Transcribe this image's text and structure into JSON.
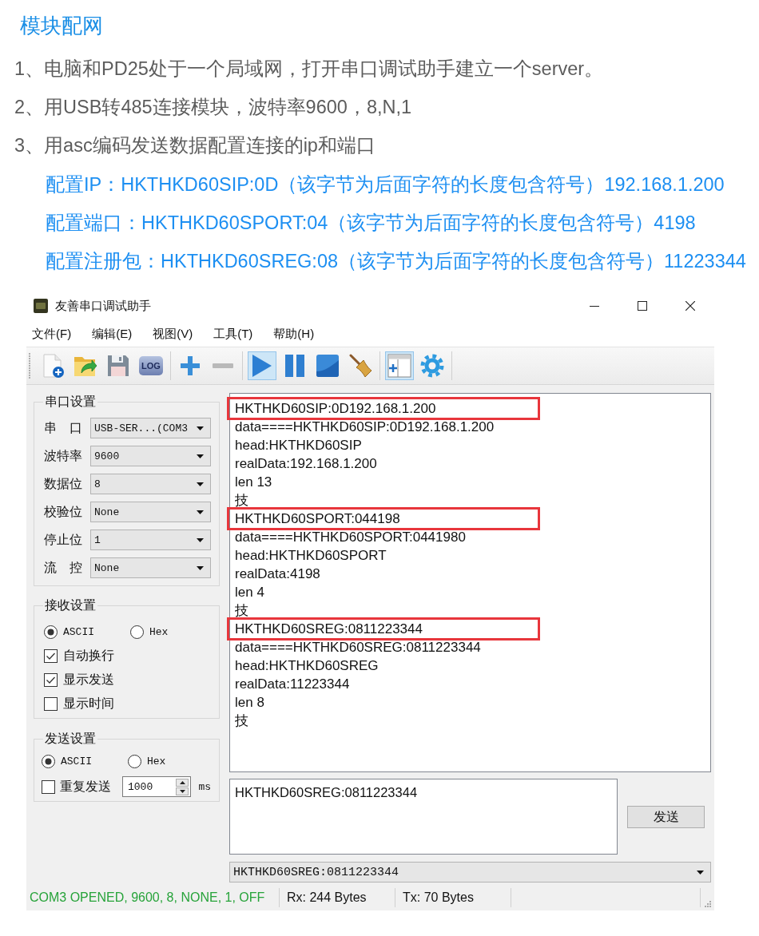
{
  "doc": {
    "heading": "模块配网",
    "steps": [
      "1、电脑和PD25处于一个局域网，打开串口调试助手建立一个server。",
      "2、用USB转485连接模块，波特率9600，8,N,1",
      "3、用asc编码发送数据配置连接的ip和端口"
    ],
    "configs": [
      "配置IP：HKTHKD60SIP:0D（该字节为后面字符的长度包含符号）192.168.1.200",
      "配置端口：HKTHKD60SPORT:04（该字节为后面字符的长度包含符号）4198",
      "配置注册包：HKTHKD60SREG:08（该字节为后面字符的长度包含符号）11223344"
    ]
  },
  "window": {
    "title": "友善串口调试助手"
  },
  "menu": [
    "文件(F)",
    "编辑(E)",
    "视图(V)",
    "工具(T)",
    "帮助(H)"
  ],
  "toolbar": [
    [
      {
        "kind": "new-file",
        "pressed": false
      },
      {
        "kind": "open-folder",
        "pressed": false
      },
      {
        "kind": "save",
        "pressed": false
      },
      {
        "kind": "log",
        "label": "LOG",
        "pressed": false
      }
    ],
    [
      {
        "kind": "plus",
        "pressed": false
      },
      {
        "kind": "minus",
        "pressed": false
      }
    ],
    [
      {
        "kind": "play",
        "pressed": true
      },
      {
        "kind": "pause",
        "pressed": false
      },
      {
        "kind": "stop",
        "pressed": false
      },
      {
        "kind": "broom",
        "pressed": false
      }
    ],
    [
      {
        "kind": "window-add",
        "pressed": true
      },
      {
        "kind": "gear",
        "pressed": false
      }
    ]
  ],
  "serial_settings": {
    "title": "串口设置",
    "fields": [
      {
        "label": "串 口",
        "value": "USB-SER...(COM3"
      },
      {
        "label": "波特率",
        "value": "9600"
      },
      {
        "label": "数据位",
        "value": "8"
      },
      {
        "label": "校验位",
        "value": "None"
      },
      {
        "label": "停止位",
        "value": "1"
      },
      {
        "label": "流 控",
        "value": "None"
      }
    ]
  },
  "receive_settings": {
    "title": "接收设置",
    "modes": [
      {
        "label": "ASCII",
        "selected": true
      },
      {
        "label": "Hex",
        "selected": false
      }
    ],
    "options": [
      {
        "label": "自动换行",
        "checked": true
      },
      {
        "label": "显示发送",
        "checked": true
      },
      {
        "label": "显示时间",
        "checked": false
      }
    ]
  },
  "send_settings": {
    "title": "发送设置",
    "modes": [
      {
        "label": "ASCII",
        "selected": true
      },
      {
        "label": "Hex",
        "selected": false
      }
    ],
    "repeat": {
      "label": "重复发送",
      "checked": false,
      "interval": "1000",
      "unit": "ms"
    }
  },
  "receive_area": {
    "lines": [
      {
        "text": "HKTHKD60SIP:0D192.168.1.200",
        "highlighted": true
      },
      {
        "text": "data====HKTHKD60SIP:0D192.168.1.200",
        "highlighted": false
      },
      {
        "text": "head:HKTHKD60SIP",
        "highlighted": false
      },
      {
        "text": "realData:192.168.1.200",
        "highlighted": false
      },
      {
        "text": "len 13",
        "highlighted": false
      },
      {
        "text": "技",
        "highlighted": false
      },
      {
        "text": "HKTHKD60SPORT:044198",
        "highlighted": true
      },
      {
        "text": "data====HKTHKD60SPORT:0441980",
        "highlighted": false
      },
      {
        "text": "head:HKTHKD60SPORT",
        "highlighted": false
      },
      {
        "text": "realData:4198",
        "highlighted": false
      },
      {
        "text": "len 4",
        "highlighted": false
      },
      {
        "text": "技",
        "highlighted": false
      },
      {
        "text": "HKTHKD60SREG:0811223344",
        "highlighted": true
      },
      {
        "text": "data====HKTHKD60SREG:0811223344",
        "highlighted": false
      },
      {
        "text": "head:HKTHKD60SREG",
        "highlighted": false
      },
      {
        "text": "realData:11223344",
        "highlighted": false
      },
      {
        "text": "len 8",
        "highlighted": false
      },
      {
        "text": "技",
        "highlighted": false
      }
    ]
  },
  "send_area": {
    "text": "HKTHKD60SREG:0811223344",
    "button": "发送"
  },
  "history": {
    "value": "HKTHKD60SREG:0811223344"
  },
  "status_bar": {
    "state": "COM3 OPENED, 9600, 8, NONE, 1, OFF",
    "rx": "Rx: 244 Bytes",
    "tx": "Tx: 70 Bytes"
  }
}
